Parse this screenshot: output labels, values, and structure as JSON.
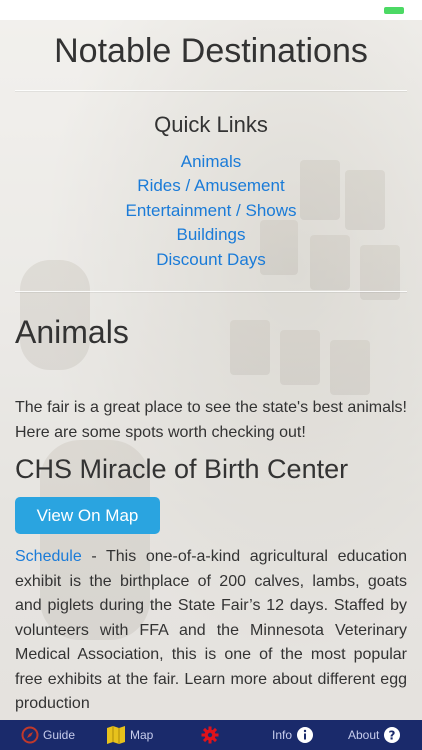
{
  "page": {
    "title": "Notable Destinations"
  },
  "quick_links": {
    "title": "Quick Links",
    "items": [
      "Animals",
      "Rides / Amusement",
      "Entertainment / Shows",
      "Buildings",
      "Discount Days"
    ]
  },
  "section": {
    "title": "Animals",
    "intro": "The fair is a great place to see the state's best animals! Here are some spots worth checking out!",
    "subsection_title": "CHS Miracle of Birth Center",
    "map_button": "View On Map",
    "schedule_link": "Schedule",
    "description": " - This one-of-a-kind agricultural education exhibit is the birthplace of 200 calves, lambs, goats and piglets during the State Fair’s 12 days. Staffed by volunteers with FFA and the Minnesota Veterinary Medical Association, this is one of the most popular free exhibits at the fair. Learn more about different egg production"
  },
  "tab_bar": {
    "tabs": [
      {
        "label": "Guide",
        "icon": "compass-icon"
      },
      {
        "label": "Map",
        "icon": "map-icon"
      },
      {
        "label": "",
        "icon": "gear-icon"
      },
      {
        "label": "Info",
        "icon": "info-icon"
      },
      {
        "label": "About",
        "icon": "question-icon"
      }
    ]
  },
  "colors": {
    "link": "#1a7bd8",
    "button": "#2aa4e0",
    "tab_bar": "#1a2a6b",
    "map_icon": "#e8c21c",
    "gear_icon": "#e0131b"
  }
}
